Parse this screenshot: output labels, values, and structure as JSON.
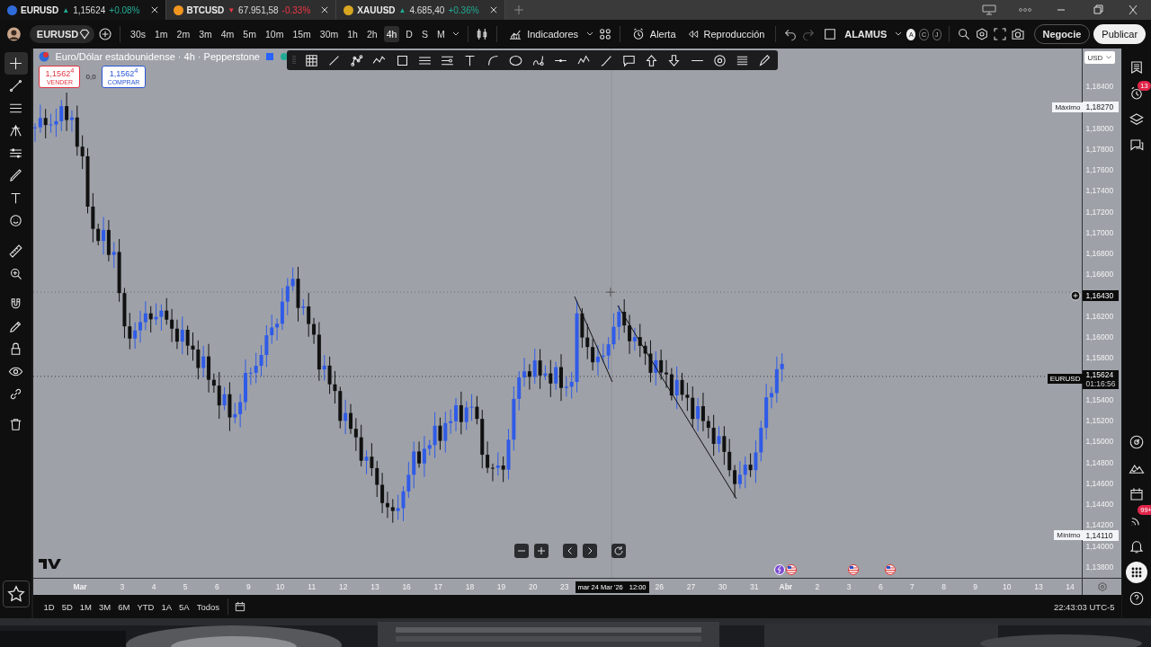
{
  "tabs": [
    {
      "symbol": "EURUSD",
      "kind": "up",
      "arrow": "▲",
      "price": "1,15624",
      "change": "+0.08%",
      "selected": true,
      "color": "#2f6bd8"
    },
    {
      "symbol": "BTCUSD",
      "kind": "down",
      "arrow": "▼",
      "price": "67.951,58",
      "change": "-0.33%",
      "selected": false,
      "color": "#f2951f"
    },
    {
      "symbol": "XAUUSD",
      "kind": "up",
      "arrow": "▲",
      "price": "4.685,40",
      "change": "+0.36%",
      "selected": false,
      "color": "#d9a621"
    }
  ],
  "toolbar": {
    "symbol": "EURUSD",
    "intervals": [
      {
        "label": "30s",
        "selected": false
      },
      {
        "label": "1m",
        "selected": false
      },
      {
        "label": "2m",
        "selected": false
      },
      {
        "label": "3m",
        "selected": false
      },
      {
        "label": "4m",
        "selected": false
      },
      {
        "label": "5m",
        "selected": false
      },
      {
        "label": "10m",
        "selected": false
      },
      {
        "label": "15m",
        "selected": false
      },
      {
        "label": "30m",
        "selected": false
      },
      {
        "label": "1h",
        "selected": false
      },
      {
        "label": "2h",
        "selected": false
      },
      {
        "label": "4h",
        "selected": true
      },
      {
        "label": "D",
        "selected": false
      },
      {
        "label": "S",
        "selected": false
      },
      {
        "label": "M",
        "selected": false
      }
    ],
    "indicators": "Indicadores",
    "alert": "Alerta",
    "replay": "Reproducción",
    "layout": "ALAMUS",
    "layout_circles": [
      {
        "label": "A",
        "selected": true
      },
      {
        "label": "C",
        "selected": false
      },
      {
        "label": "J",
        "selected": false
      }
    ],
    "trade": "Negocie",
    "publish": "Publicar"
  },
  "left_tools": [
    {
      "kind": "crosshair",
      "selected": true
    },
    {
      "kind": "line",
      "selected": false
    },
    {
      "kind": "fib",
      "selected": false
    },
    {
      "kind": "pitchfork",
      "selected": false
    },
    {
      "kind": "channel",
      "selected": false
    },
    {
      "kind": "brush",
      "selected": false
    },
    {
      "kind": "text",
      "selected": false
    },
    {
      "kind": "emoji",
      "selected": false
    },
    {
      "kind": "ruler",
      "selected": false
    },
    {
      "kind": "zoom",
      "selected": false
    },
    {
      "kind": "magnet",
      "selected": false
    },
    {
      "kind": "pencil",
      "selected": false
    },
    {
      "kind": "lock",
      "selected": false
    },
    {
      "kind": "eye",
      "selected": false
    },
    {
      "kind": "link",
      "selected": false
    },
    {
      "kind": "trash",
      "selected": false
    }
  ],
  "legend": {
    "title": "Euro/Dólar estadounidense · 4h · Pepperstone",
    "sell": {
      "price": "1,1562$^{4}$",
      "label": "VENDER"
    },
    "spread": "0,0",
    "buy": {
      "price": "1,1562$^{4}$",
      "label": "COMPRAR"
    }
  },
  "price_axis": {
    "currency": "USD",
    "items": [
      {
        "kind": "tick",
        "label": "1,18400"
      },
      {
        "kind": "high",
        "tag": "Máximo",
        "value": "1,18270"
      },
      {
        "kind": "tick",
        "label": "1,18000"
      },
      {
        "kind": "tick",
        "label": "1,17800"
      },
      {
        "kind": "tick",
        "label": "1,17600"
      },
      {
        "kind": "tick",
        "label": "1,17400"
      },
      {
        "kind": "tick",
        "label": "1,17200"
      },
      {
        "kind": "tick",
        "label": "1,17000"
      },
      {
        "kind": "tick",
        "label": "1,16800"
      },
      {
        "kind": "tick",
        "label": "1,16600"
      },
      {
        "kind": "crosshair",
        "value": "1,16430"
      },
      {
        "kind": "tick",
        "label": "1,16200"
      },
      {
        "kind": "tick",
        "label": "1,16000"
      },
      {
        "kind": "tick",
        "label": "1,15800"
      },
      {
        "kind": "last",
        "tag": "EURUSD",
        "value": "1,15624",
        "countdown": "01:16:56"
      },
      {
        "kind": "tick",
        "label": "1,15400"
      },
      {
        "kind": "tick",
        "label": "1,15200"
      },
      {
        "kind": "tick",
        "label": "1,15000"
      },
      {
        "kind": "tick",
        "label": "1,14800"
      },
      {
        "kind": "tick",
        "label": "1,14600"
      },
      {
        "kind": "tick",
        "label": "1,14400"
      },
      {
        "kind": "tick",
        "label": "1,14200"
      },
      {
        "kind": "low",
        "tag": "Mínimo",
        "value": "1,14110"
      },
      {
        "kind": "tick",
        "label": "1,14000"
      },
      {
        "kind": "tick",
        "label": "1,13800"
      }
    ]
  },
  "time_axis": [
    {
      "kind": "month",
      "label": "Mar"
    },
    {
      "kind": "day",
      "label": "3"
    },
    {
      "kind": "day",
      "label": "4"
    },
    {
      "kind": "day",
      "label": "5"
    },
    {
      "kind": "day",
      "label": "6"
    },
    {
      "kind": "day",
      "label": "9"
    },
    {
      "kind": "day",
      "label": "10"
    },
    {
      "kind": "day",
      "label": "11"
    },
    {
      "kind": "day",
      "label": "12"
    },
    {
      "kind": "day",
      "label": "13"
    },
    {
      "kind": "day",
      "label": "16"
    },
    {
      "kind": "day",
      "label": "17"
    },
    {
      "kind": "day",
      "label": "18"
    },
    {
      "kind": "day",
      "label": "19"
    },
    {
      "kind": "day",
      "label": "20"
    },
    {
      "kind": "day",
      "label": "23"
    },
    {
      "kind": "cursor",
      "label": "mar 24 Mar '26",
      "time": "12:00"
    },
    {
      "kind": "day",
      "label": "26"
    },
    {
      "kind": "day",
      "label": "27"
    },
    {
      "kind": "day",
      "label": "30"
    },
    {
      "kind": "day",
      "label": "31"
    },
    {
      "kind": "month",
      "label": "Abr"
    },
    {
      "kind": "day",
      "label": "2"
    },
    {
      "kind": "day",
      "label": "3"
    },
    {
      "kind": "day",
      "label": "6"
    },
    {
      "kind": "day",
      "label": "7"
    },
    {
      "kind": "day",
      "label": "8"
    },
    {
      "kind": "day",
      "label": "9"
    },
    {
      "kind": "day",
      "label": "10"
    },
    {
      "kind": "day",
      "label": "13"
    },
    {
      "kind": "day",
      "label": "14"
    }
  ],
  "sidebar": {
    "alerts_badge": "13",
    "news_badge": "99+"
  },
  "bottom_bar": {
    "ranges": [
      "1D",
      "5D",
      "1M",
      "3M",
      "6M",
      "YTD",
      "1A",
      "5A",
      "Todos"
    ],
    "clock": "22:43:03 UTC-5"
  }
}
